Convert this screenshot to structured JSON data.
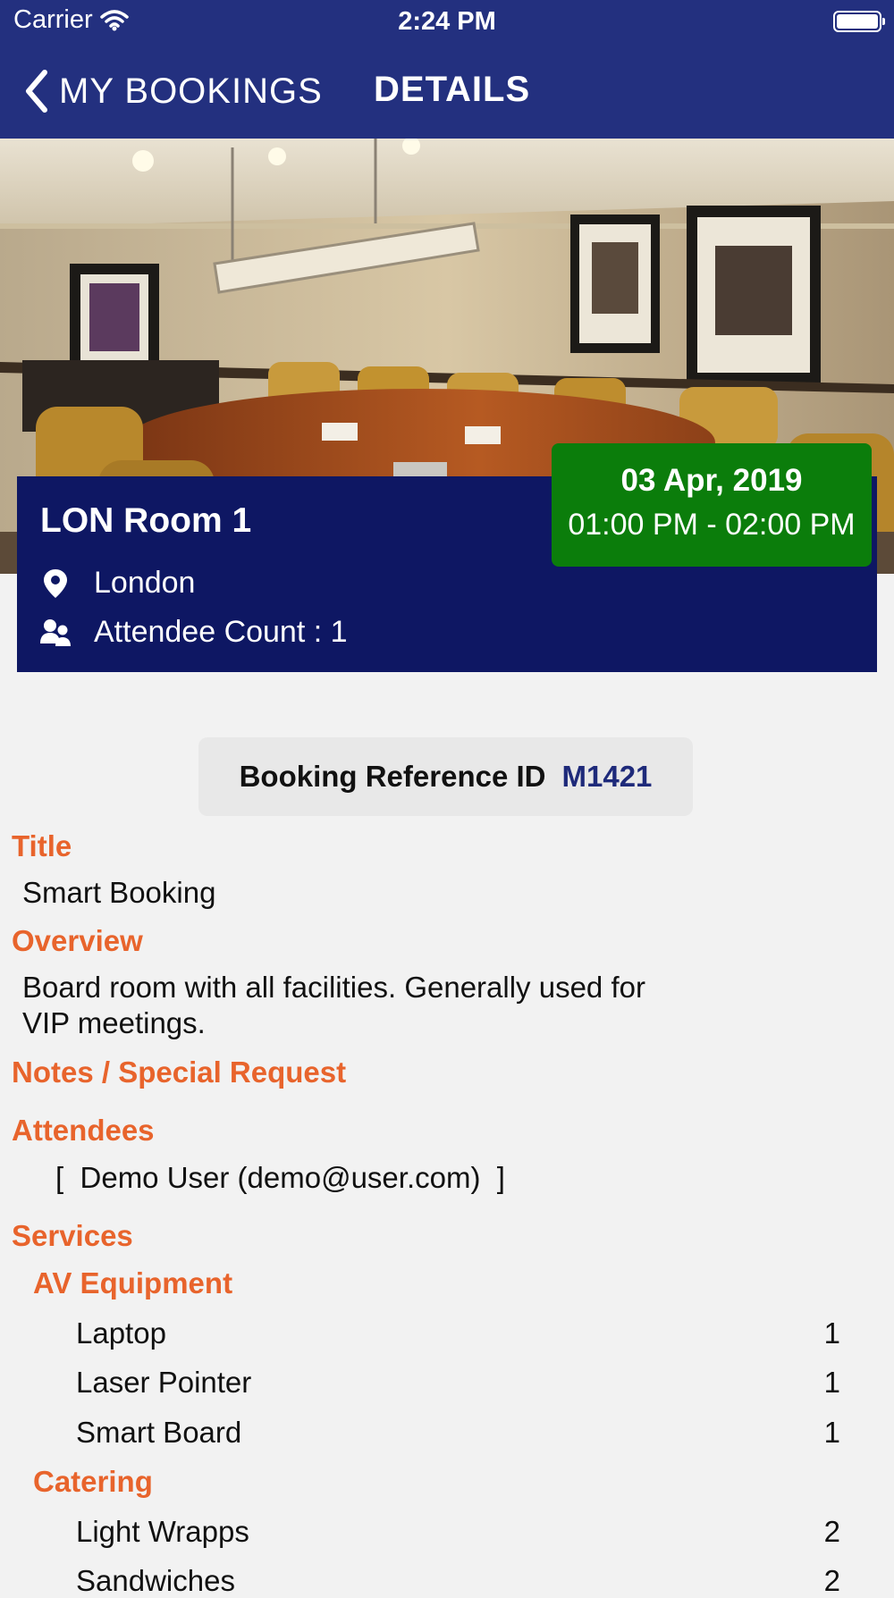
{
  "status_bar": {
    "carrier": "Carrier",
    "time": "2:24 PM"
  },
  "nav": {
    "back_label": "MY BOOKINGS",
    "title": "DETAILS"
  },
  "booking": {
    "room_name": "LON Room 1",
    "location": "London",
    "attendee_count": "Attendee Count : 1",
    "date": "03 Apr, 2019",
    "time_range": "01:00 PM - 02:00 PM",
    "reference_label": "Booking Reference ID",
    "reference_id": "M1421"
  },
  "details": {
    "title_label": "Title",
    "title_value": "Smart Booking",
    "overview_label": "Overview",
    "overview_line1": "Board room with all facilities. Generally used for",
    "overview_line2": "VIP meetings.",
    "notes_label": "Notes / Special Request",
    "attendees_label": "Attendees",
    "attendees_value": "[  Demo User (demo@user.com)  ]",
    "services_label": "Services"
  },
  "services": [
    {
      "category": "AV Equipment",
      "items": [
        {
          "name": "Laptop",
          "qty": "1"
        },
        {
          "name": "Laser Pointer",
          "qty": "1"
        },
        {
          "name": "Smart Board",
          "qty": "1"
        }
      ]
    },
    {
      "category": "Catering",
      "items": [
        {
          "name": "Light Wrapps",
          "qty": "2"
        },
        {
          "name": "Sandwiches",
          "qty": "2"
        }
      ]
    }
  ],
  "colors": {
    "nav_bg": "#23307f",
    "card_bg": "#0e1763",
    "badge_bg": "#0b7d0b",
    "accent": "#e8642c",
    "reference_id": "#1e2a7a"
  },
  "icons": [
    "wifi-icon",
    "battery-icon",
    "chevron-left-icon",
    "location-pin-icon",
    "users-icon"
  ]
}
